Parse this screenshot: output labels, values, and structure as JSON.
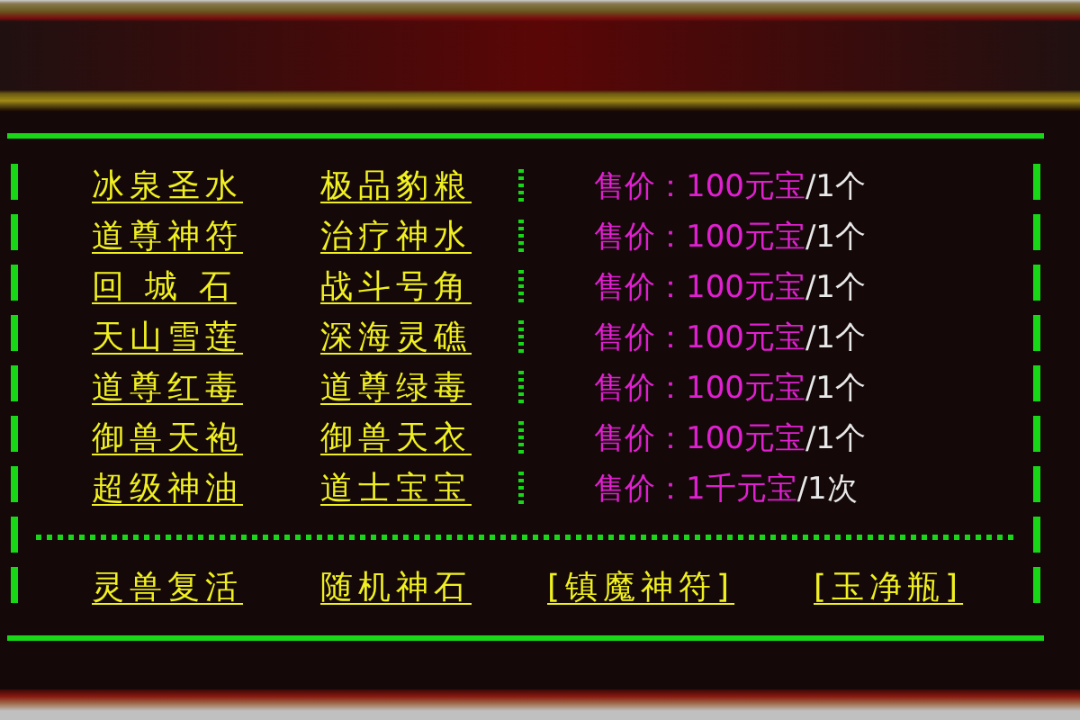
{
  "items": [
    {
      "item_1": "冰泉圣水",
      "item_2": "极品豹粮",
      "price": "售价：100元宝",
      "unit": "/1个"
    },
    {
      "item_1": "道尊神符",
      "item_2": "治疗神水",
      "price": "售价：100元宝",
      "unit": "/1个"
    },
    {
      "item_1": "回 城 石",
      "item_2": "战斗号角",
      "price": "售价：100元宝",
      "unit": "/1个"
    },
    {
      "item_1": "天山雪莲",
      "item_2": "深海灵礁",
      "price": "售价：100元宝",
      "unit": "/1个"
    },
    {
      "item_1": "道尊红毒",
      "item_2": "道尊绿毒",
      "price": "售价：100元宝",
      "unit": "/1个"
    },
    {
      "item_1": "御兽天袍",
      "item_2": "御兽天衣",
      "price": "售价：100元宝",
      "unit": "/1个"
    },
    {
      "item_1": "超级神油",
      "item_2": "道士宝宝",
      "price": "售价：1千元宝",
      "unit": "/1次"
    }
  ],
  "bottom_links": [
    "灵兽复活",
    "随机神石",
    "[镇魔神符]",
    "[玉净瓶]"
  ]
}
